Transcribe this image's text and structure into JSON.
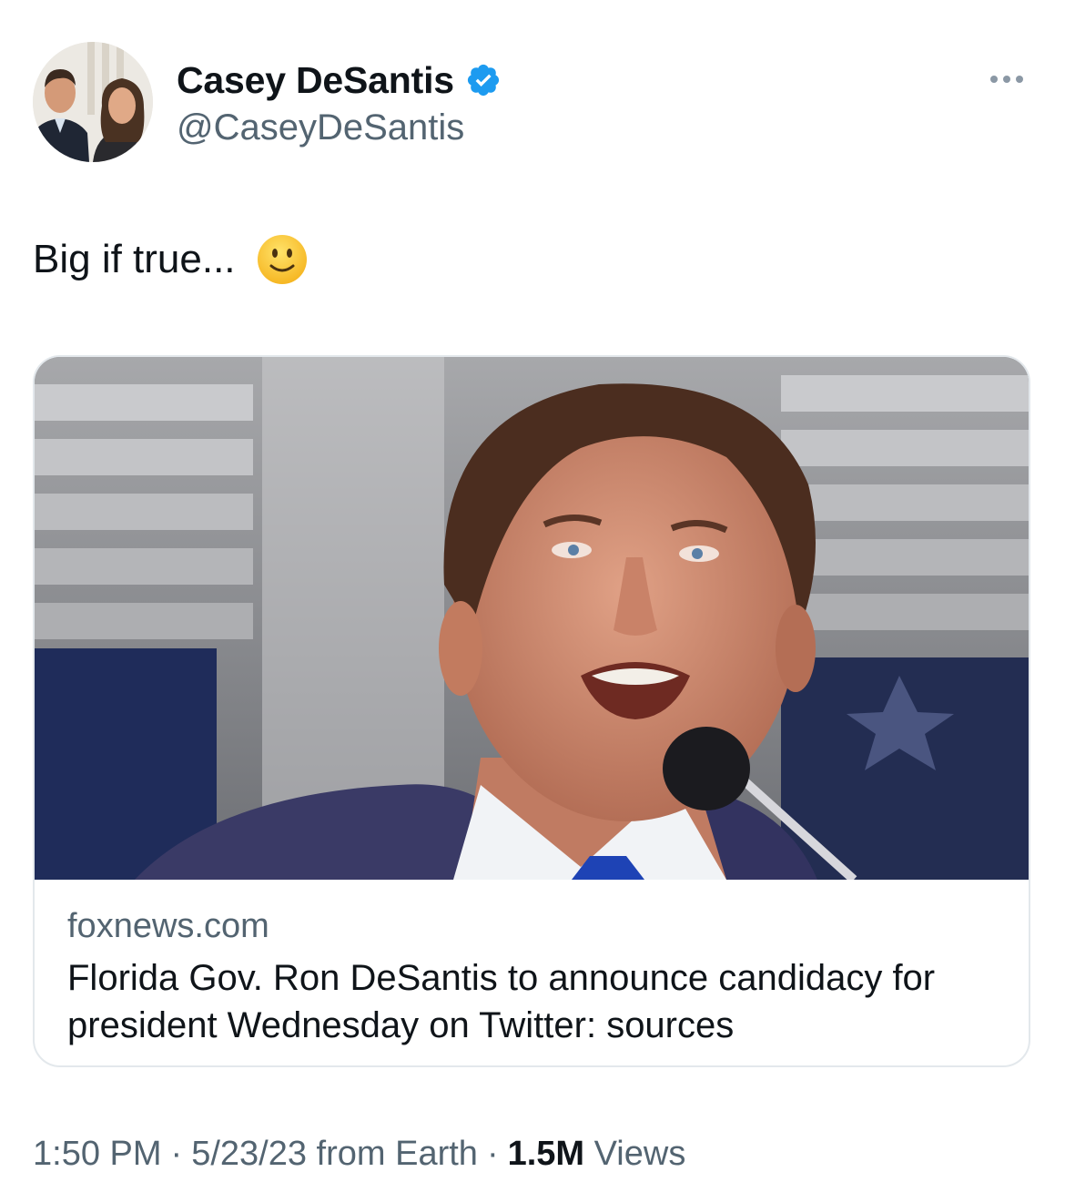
{
  "author": {
    "display_name": "Casey DeSantis",
    "handle": "@CaseyDeSantis",
    "verified": true,
    "verified_color": "#1d9bf0"
  },
  "tweet": {
    "text": "Big if true...",
    "emoji": "slightly-smiling-face-emoji"
  },
  "card": {
    "domain": "foxnews.com",
    "title": "Florida Gov. Ron DeSantis to announce candidacy for president Wednesday on Twitter: sources"
  },
  "meta": {
    "time": "1:50 PM",
    "date": "5/23/23",
    "source": "from Earth",
    "views_count": "1.5M",
    "views_label": "Views"
  },
  "colors": {
    "text": "#0f1419",
    "secondary": "#536471",
    "border": "#e3e8ec"
  }
}
